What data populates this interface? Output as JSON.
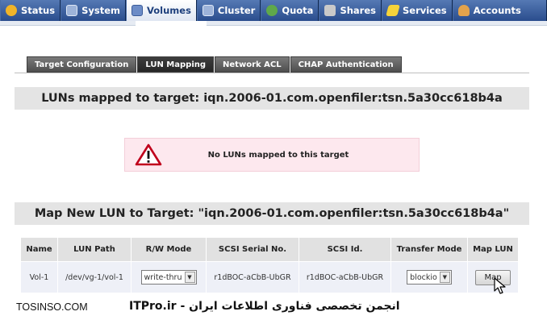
{
  "nav": {
    "tabs": [
      {
        "label": "Status",
        "icon": "status-icon",
        "color": "#f0b429"
      },
      {
        "label": "System",
        "icon": "system-icon",
        "color": "#9db3d9"
      },
      {
        "label": "Volumes",
        "icon": "volumes-icon",
        "color": "#6c8cc7"
      },
      {
        "label": "Cluster",
        "icon": "cluster-icon",
        "color": "#9db3d9"
      },
      {
        "label": "Quota",
        "icon": "quota-icon",
        "color": "#5fa84b"
      },
      {
        "label": "Shares",
        "icon": "shares-icon",
        "color": "#c9c9c9"
      },
      {
        "label": "Services",
        "icon": "services-icon",
        "color": "#f5d33a"
      },
      {
        "label": "Accounts",
        "icon": "accounts-icon",
        "color": "#e3a34c"
      }
    ],
    "active": "Volumes"
  },
  "subtabs": [
    "Target Configuration",
    "LUN Mapping",
    "Network ACL",
    "CHAP Authentication"
  ],
  "active_subtab": "LUN Mapping",
  "mapped_title": "LUNs mapped to target: iqn.2006-01.com.openfiler:tsn.5a30cc618b4a",
  "warning": {
    "text": "No LUNs mapped to this target"
  },
  "map_title": "Map New LUN to Target: \"iqn.2006-01.com.openfiler:tsn.5a30cc618b4a\"",
  "table": {
    "headers": [
      "Name",
      "LUN Path",
      "R/W Mode",
      "SCSI Serial No.",
      "SCSI Id.",
      "Transfer Mode",
      "Map LUN"
    ],
    "row": {
      "name": "Vol-1",
      "path": "/dev/vg-1/vol-1",
      "rw_mode": "write-thru",
      "serial": "r1dBOC-aCbB-UbGR",
      "scsi_id": "r1dBOC-aCbB-UbGR",
      "transfer_mode": "blockio",
      "button": "Map"
    }
  },
  "watermark": {
    "left": "TOSINSO.COM",
    "right": "ITPro.ir - انجمن تخصصی فناوری اطلاعات ایران"
  }
}
